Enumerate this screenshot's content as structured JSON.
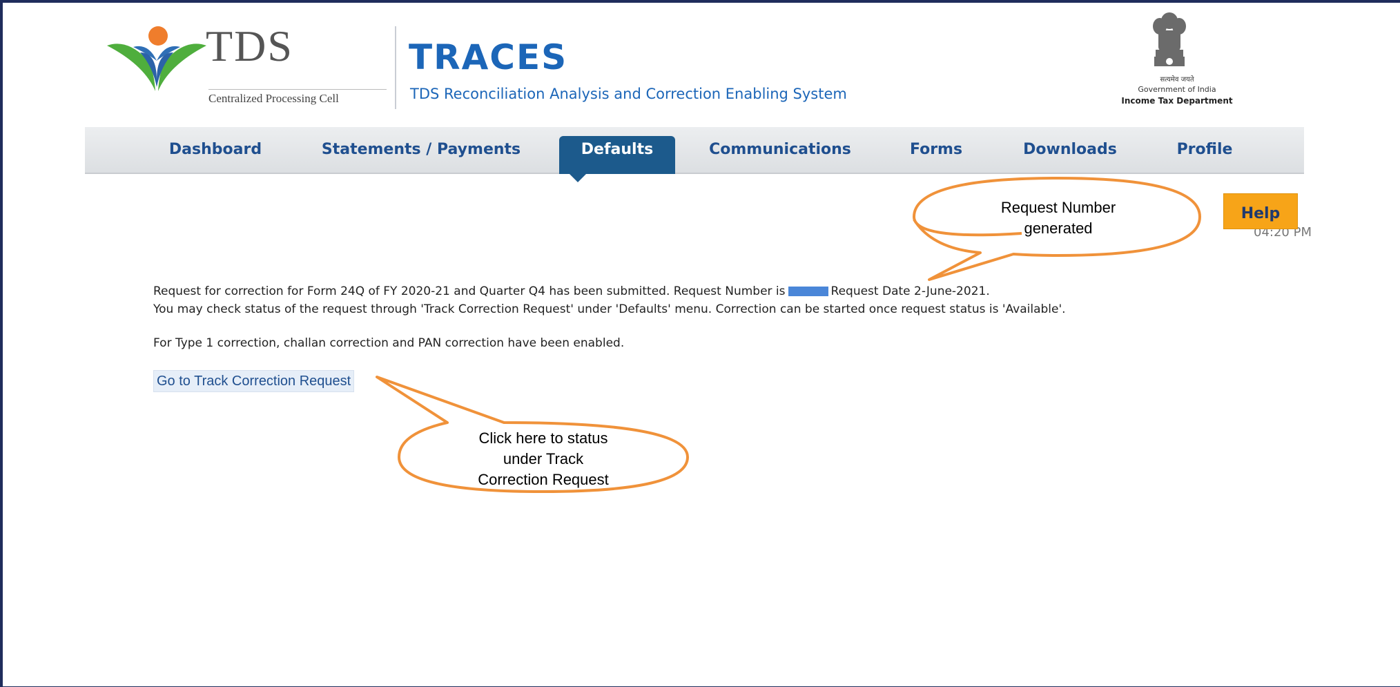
{
  "header": {
    "tds_logo_text": "TDS",
    "tds_subtitle": "Centralized Processing Cell",
    "traces_title": "TRACES",
    "traces_subtitle": "TDS Reconciliation Analysis and Correction Enabling System",
    "gov_line1": "सत्यमेव जयते",
    "gov_line2": "Government of India",
    "gov_line3": "Income Tax Department"
  },
  "nav": {
    "items": [
      {
        "label": "Dashboard",
        "active": false
      },
      {
        "label": "Statements / Payments",
        "active": false
      },
      {
        "label": "Defaults",
        "active": true
      },
      {
        "label": "Communications",
        "active": false
      },
      {
        "label": "Forms",
        "active": false
      },
      {
        "label": "Downloads",
        "active": false
      },
      {
        "label": "Profile",
        "active": false
      }
    ]
  },
  "help_label": "Help",
  "time_text": "04:20 PM",
  "messages": {
    "line1_part1": "Request for correction for Form 24Q of FY 2020-21 and Quarter Q4 has been submitted. Request Number is",
    "line1_part2": "Request Date 2-June-2021.",
    "line2": "You may check status of the request through 'Track Correction Request' under 'Defaults' menu. Correction can be started once request status is 'Available'.",
    "line3": "For Type 1 correction, challan correction and PAN correction have been enabled."
  },
  "track_link_label": "Go to Track Correction Request",
  "callouts": {
    "request_number": [
      "Request Number",
      "generated"
    ],
    "track_link": [
      "Click here to status",
      "under Track",
      "Correction Request"
    ]
  },
  "colors": {
    "frame": "#1f2d5c",
    "traces_blue": "#1c66b8",
    "nav_active": "#1c5a8c",
    "help_orange": "#f7a418",
    "callout_orange": "#f0923a"
  }
}
